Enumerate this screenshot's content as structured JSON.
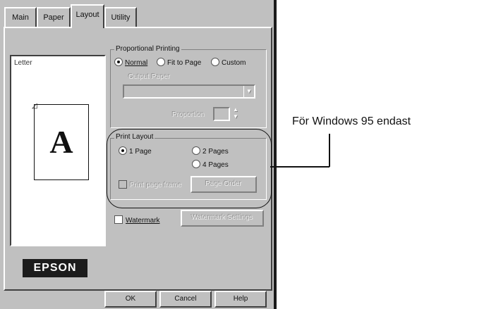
{
  "tabs": [
    "Main",
    "Paper",
    "Layout",
    "Utility"
  ],
  "active_tab": "Layout",
  "preview": {
    "paper_label": "Letter",
    "sample_letter": "A"
  },
  "proportional": {
    "group_label": "Proportional Printing",
    "options": [
      "Normal",
      "Fit to Page",
      "Custom"
    ],
    "selected": "Normal",
    "output_label": "Output Paper",
    "output_value": "",
    "proportion_label": "Proportion"
  },
  "print_layout": {
    "group_label": "Print Layout",
    "options": [
      "1 Page",
      "2 Pages",
      "4 Pages"
    ],
    "selected": "1 Page",
    "frame_label": "Print page frame",
    "order_button": "Page Order"
  },
  "watermark": {
    "label": "Watermark",
    "settings_button": "Watermark Settings"
  },
  "logo_text": "EPSON",
  "buttons": {
    "ok": "OK",
    "cancel": "Cancel",
    "help": "Help"
  },
  "callout": "För Windows 95 endast"
}
